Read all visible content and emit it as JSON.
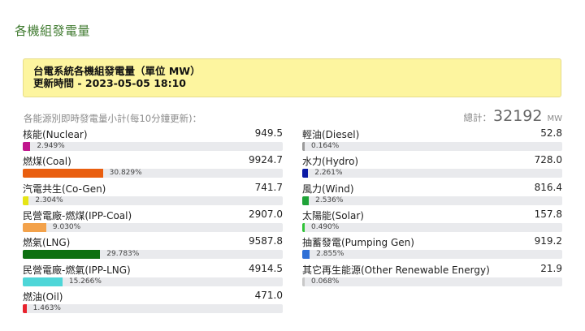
{
  "page_title": "各機組發電量",
  "info": {
    "heading": "台電系統各機組發電量（單位 MW）",
    "updated": "更新時間 - 2023-05-05 18:10"
  },
  "subtitle": "各能源別即時發電量小計(每10分鐘更新)：",
  "total": {
    "label": "總計：",
    "value": "32192",
    "unit": "MW"
  },
  "left_sources": [
    {
      "name": "核能(Nuclear)",
      "value": "949.5",
      "percent": "2.949%",
      "fraction": 0.02949,
      "color": "#c0168d"
    },
    {
      "name": "燃煤(Coal)",
      "value": "9924.7",
      "percent": "30.829%",
      "fraction": 0.30829,
      "color": "#e95e0f"
    },
    {
      "name": "汽電共生(Co-Gen)",
      "value": "741.7",
      "percent": "2.304%",
      "fraction": 0.02304,
      "color": "#e6e516"
    },
    {
      "name": "民營電廠-燃煤(IPP-Coal)",
      "value": "2907.0",
      "percent": "9.030%",
      "fraction": 0.0903,
      "color": "#f3a24b"
    },
    {
      "name": "燃氣(LNG)",
      "value": "9587.8",
      "percent": "29.783%",
      "fraction": 0.29783,
      "color": "#0d7010"
    },
    {
      "name": "民營電廠-燃氣(IPP-LNG)",
      "value": "4914.5",
      "percent": "15.266%",
      "fraction": 0.15266,
      "color": "#4ed6d8"
    },
    {
      "name": "燃油(Oil)",
      "value": "471.0",
      "percent": "1.463%",
      "fraction": 0.01463,
      "color": "#e8232e"
    }
  ],
  "right_sources": [
    {
      "name": "輕油(Diesel)",
      "value": "52.8",
      "percent": "0.164%",
      "fraction": 0.00164,
      "color": "#9b9b9b"
    },
    {
      "name": "水力(Hydro)",
      "value": "728.0",
      "percent": "2.261%",
      "fraction": 0.02261,
      "color": "#0b1aa5"
    },
    {
      "name": "風力(Wind)",
      "value": "816.4",
      "percent": "2.536%",
      "fraction": 0.02536,
      "color": "#1fa338"
    },
    {
      "name": "太陽能(Solar)",
      "value": "157.8",
      "percent": "0.490%",
      "fraction": 0.0049,
      "color": "#31c43a"
    },
    {
      "name": "抽蓄發電(Pumping Gen)",
      "value": "919.2",
      "percent": "2.855%",
      "fraction": 0.02855,
      "color": "#2e6fd6"
    },
    {
      "name": "其它再生能源(Other Renewable Energy)",
      "value": "21.9",
      "percent": "0.068%",
      "fraction": 0.00068,
      "color": "#c8c8c8"
    }
  ]
}
